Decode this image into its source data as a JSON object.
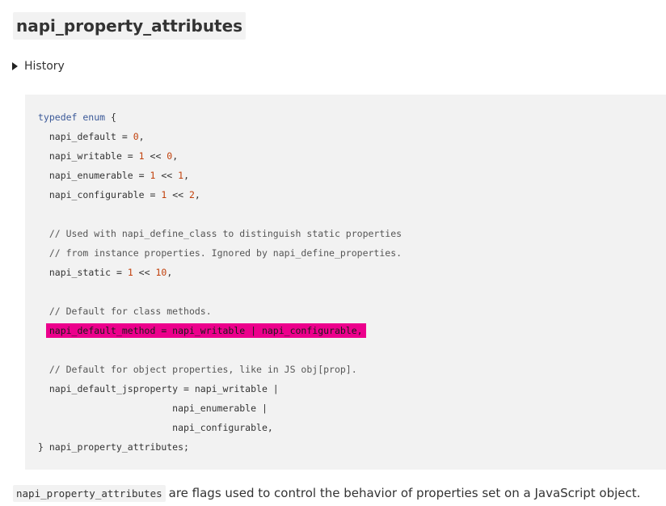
{
  "section": {
    "title": "napi_property_attributes",
    "history_label": "History"
  },
  "code": {
    "line1_kw": "typedef enum",
    "line1_rest": " {",
    "line2_name": "napi_default",
    "line2_eq": " = ",
    "line2_val": "0",
    "line2_end": ",",
    "line3_name": "napi_writable",
    "line3_eq": " = ",
    "line3_a": "1",
    "line3_op": " << ",
    "line3_b": "0",
    "line3_end": ",",
    "line4_name": "napi_enumerable",
    "line4_eq": " = ",
    "line4_a": "1",
    "line4_op": " << ",
    "line4_b": "1",
    "line4_end": ",",
    "line5_name": "napi_configurable",
    "line5_eq": " = ",
    "line5_a": "1",
    "line5_op": " << ",
    "line5_b": "2",
    "line5_end": ",",
    "comment1": "// Used with napi_define_class to distinguish static properties",
    "comment2": "// from instance properties. Ignored by napi_define_properties.",
    "line6_name": "napi_static",
    "line6_eq": " = ",
    "line6_a": "1",
    "line6_op": " << ",
    "line6_b": "10",
    "line6_end": ",",
    "comment3": "// Default for class methods.",
    "highlighted_line": "napi_default_method = napi_writable | napi_configurable,",
    "comment4": "// Default for object properties, like in JS obj[prop].",
    "line7": "napi_default_jsproperty = napi_writable |",
    "line8": "napi_enumerable |",
    "line9": "napi_configurable,",
    "line10": "} napi_property_attributes;"
  },
  "description": {
    "code_term": "napi_property_attributes",
    "text": "are flags used to control the behavior of properties set on a JavaScript object."
  },
  "colors": {
    "highlight": "#ec008c",
    "code_background": "#f2f2f2",
    "number": "#c2410c",
    "keyword": "#3b5998"
  }
}
